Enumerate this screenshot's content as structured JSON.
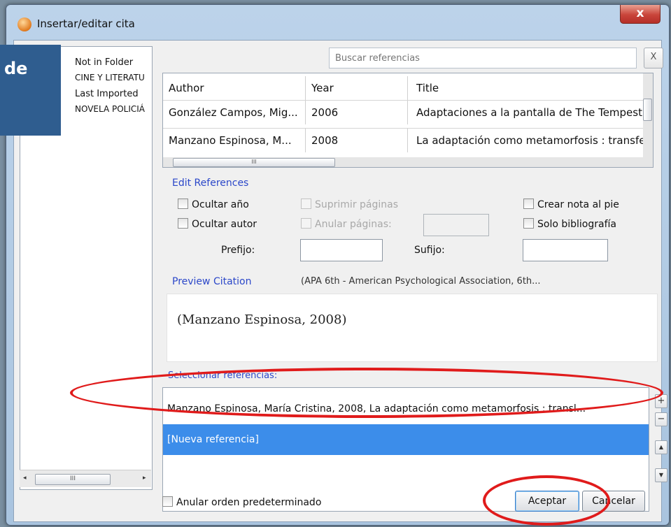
{
  "window": {
    "title": "Insertar/editar cita",
    "close_label": "x"
  },
  "folders": {
    "items": [
      "Not in Folder",
      "CINE Y LITERATU",
      "Last Imported",
      "NOVELA POLICIÁ"
    ],
    "scroll_thumb": "III",
    "scroll_left": "◂",
    "scroll_right": "▸"
  },
  "search": {
    "placeholder": "Buscar referencias",
    "clear_label": "X"
  },
  "references_table": {
    "columns": [
      "Author",
      "Year",
      "Title"
    ],
    "rows": [
      {
        "author": "González Campos, Mig...",
        "year": "2006",
        "title": "Adaptaciones a la pantalla de The Tempest c"
      },
      {
        "author": "Manzano Espinosa, M...",
        "year": "2008",
        "title": "La adaptación como metamorfosis : transfer"
      }
    ],
    "hscroll_thumb": "III"
  },
  "edit_references": {
    "label": "Edit References",
    "hide_year": "Ocultar año",
    "hide_author": "Ocultar autor",
    "suppress_pages": "Suprimir páginas",
    "override_pages": "Anular páginas:",
    "create_footnote": "Crear nota al pie",
    "bibliography_only": "Solo bibliografía",
    "prefix_label": "Prefijo:",
    "suffix_label": "Sufijo:"
  },
  "preview": {
    "label": "Preview Citation",
    "style": "(APA 6th - American Psychological Association, 6th...",
    "text": "(Manzano Espinosa, 2008)"
  },
  "select_references": {
    "label": "Seleccionar referencias:",
    "items": [
      "Manzano Espinosa, María Cristina, 2008, La adaptación como metamorfosis : transl...",
      "[Nueva referencia]"
    ],
    "add_label": "+",
    "remove_label": "−",
    "up_label": "▲",
    "down_label": "▼"
  },
  "footer": {
    "override_default_order": "Anular orden predeterminado",
    "accept_label": "Aceptar",
    "cancel_label": "Cancelar"
  },
  "overlay": {
    "text": "de"
  },
  "colors": {
    "selection": "#3c8dea",
    "section_label": "#2b47c9",
    "annotation": "#e01b1b"
  }
}
